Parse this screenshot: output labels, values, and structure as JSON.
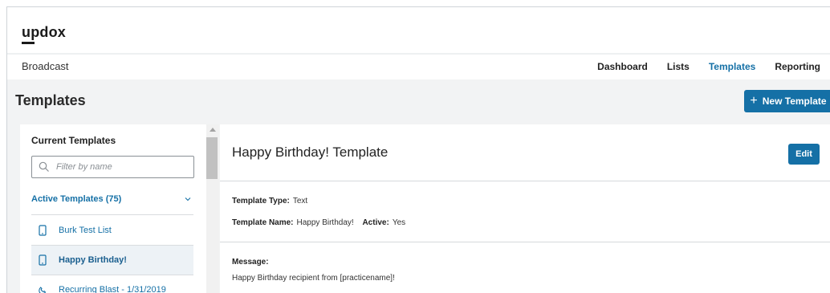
{
  "brand": {
    "logo": "updox"
  },
  "subnav": {
    "app_name": "Broadcast",
    "items": [
      {
        "label": "Dashboard",
        "active": false
      },
      {
        "label": "Lists",
        "active": false
      },
      {
        "label": "Templates",
        "active": true
      },
      {
        "label": "Reporting",
        "active": false
      }
    ]
  },
  "page": {
    "title": "Templates",
    "new_button": {
      "icon": "plus-icon",
      "label": "New Template"
    }
  },
  "left_panel": {
    "title": "Current Templates",
    "filter_placeholder": "Filter by name",
    "group": {
      "label": "Active Templates (75)",
      "expanded": true
    },
    "items": [
      {
        "label": "Burk Test List",
        "icon": "mobile-phone-icon",
        "selected": false
      },
      {
        "label": "Happy Birthday!",
        "icon": "mobile-phone-icon",
        "selected": true
      },
      {
        "label": "Recurring Blast - 1/31/2019",
        "icon": "phone-handset-icon",
        "selected": false
      }
    ]
  },
  "detail": {
    "title": "Happy Birthday! Template",
    "edit_label": "Edit",
    "type_label": "Template Type:",
    "type_value": "Text",
    "name_label": "Template Name:",
    "name_value": "Happy Birthday!",
    "active_label": "Active:",
    "active_value": "Yes",
    "message_label": "Message:",
    "message_value": "Happy Birthday recipient from [practicename]!"
  },
  "colors": {
    "accent": "#1570a6",
    "page_bg": "#f2f3f4",
    "selected_bg": "#edf2f6"
  }
}
